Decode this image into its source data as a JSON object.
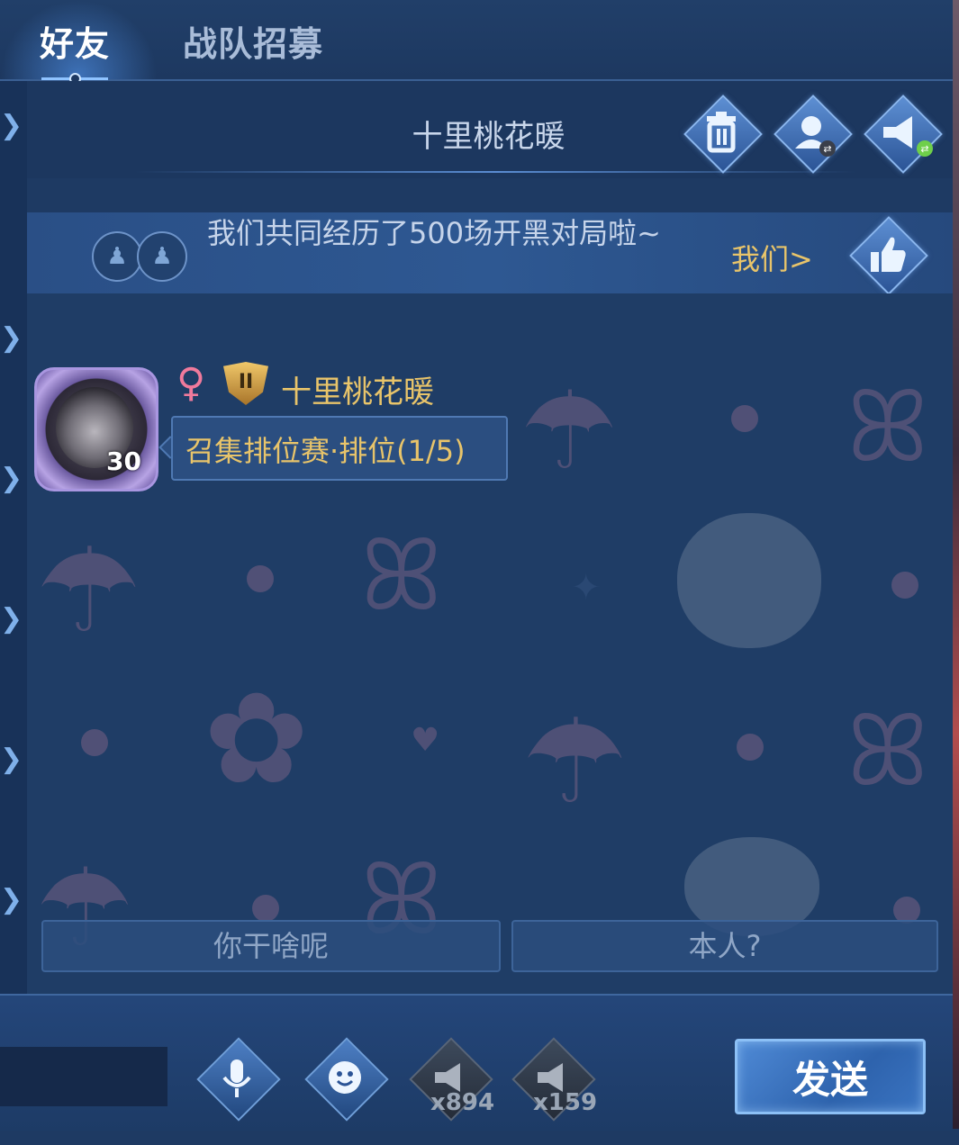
{
  "tabs": [
    {
      "label": "好友",
      "active": true
    },
    {
      "label": "战队招募",
      "active": false
    }
  ],
  "chat": {
    "title": "十里桃花暖",
    "header_icons": [
      "trash-icon",
      "switch-profile-icon",
      "switch-broadcast-icon"
    ]
  },
  "banner": {
    "text": "我们共同经历了500场开黑对局啦~",
    "link_label": "我们>",
    "like_icon": "thumbs-up-icon"
  },
  "message": {
    "sender": "十里桃花暖",
    "level": "30",
    "gender_icon": "female-icon",
    "rank_badge": "II",
    "text": "召集排位赛·排位(1/5)"
  },
  "quick_replies": [
    "你干啥呢",
    "本人?"
  ],
  "bottom_bar": {
    "input_value": "",
    "mic_icon": "microphone-icon",
    "emoji_icon": "emoji-icon",
    "horn_counts": [
      "x894",
      "x159"
    ],
    "send_label": "发送"
  },
  "colors": {
    "accent_gold": "#e8c46a",
    "panel_blue": "#1f3d66",
    "gender_pink": "#f07a9c"
  }
}
